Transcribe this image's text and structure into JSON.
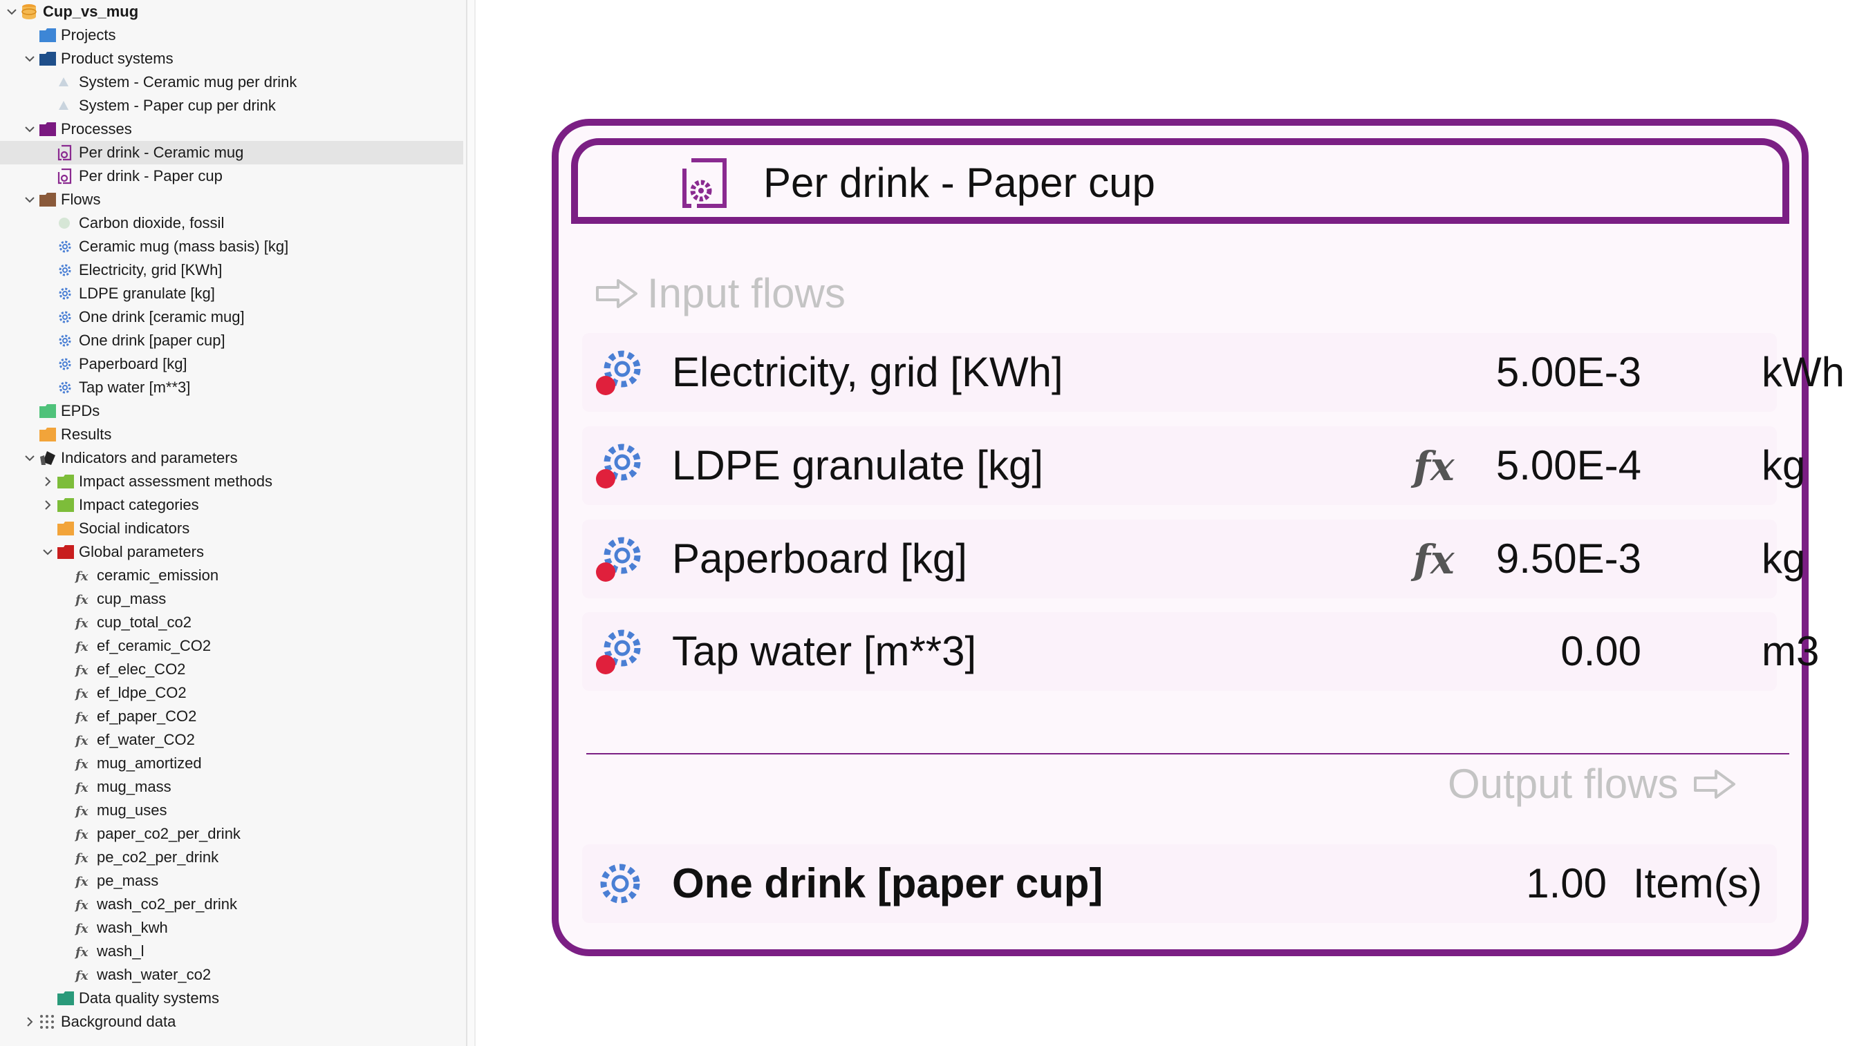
{
  "tree": {
    "root": "Cup_vs_mug",
    "items": [
      {
        "label": "Projects",
        "icon": "folder-blue-icon"
      },
      {
        "label": "Product systems",
        "icon": "folder-navy-icon"
      },
      {
        "label": "System - Ceramic mug per drink",
        "icon": "product-system-icon"
      },
      {
        "label": "System - Paper cup per drink",
        "icon": "product-system-icon"
      },
      {
        "label": "Processes",
        "icon": "folder-purple-icon"
      },
      {
        "label": "Per drink - Ceramic mug",
        "icon": "process-icon"
      },
      {
        "label": "Per drink - Paper cup",
        "icon": "process-icon"
      },
      {
        "label": "Flows",
        "icon": "folder-brown-icon"
      },
      {
        "label": "Carbon dioxide, fossil",
        "icon": "elementary-flow-icon"
      },
      {
        "label": "Ceramic mug (mass basis) [kg]",
        "icon": "product-flow-icon"
      },
      {
        "label": "Electricity, grid [KWh]",
        "icon": "product-flow-icon"
      },
      {
        "label": "LDPE granulate [kg]",
        "icon": "product-flow-icon"
      },
      {
        "label": "One drink [ceramic mug]",
        "icon": "product-flow-icon"
      },
      {
        "label": "One drink [paper cup]",
        "icon": "product-flow-icon"
      },
      {
        "label": "Paperboard [kg]",
        "icon": "product-flow-icon"
      },
      {
        "label": "Tap water [m**3]",
        "icon": "product-flow-icon"
      },
      {
        "label": "EPDs",
        "icon": "folder-green-icon"
      },
      {
        "label": "Results",
        "icon": "folder-orange-icon"
      },
      {
        "label": "Indicators and parameters",
        "icon": "indicators-icon"
      },
      {
        "label": "Impact assessment methods",
        "icon": "folder-lime-icon"
      },
      {
        "label": "Impact categories",
        "icon": "folder-lime-icon"
      },
      {
        "label": "Social indicators",
        "icon": "folder-orange-icon"
      },
      {
        "label": "Global parameters",
        "icon": "folder-red-icon"
      },
      {
        "label": "ceramic_emission",
        "icon": "fx-parameter-icon"
      },
      {
        "label": "cup_mass",
        "icon": "fx-parameter-icon"
      },
      {
        "label": "cup_total_co2",
        "icon": "fx-parameter-icon"
      },
      {
        "label": "ef_ceramic_CO2",
        "icon": "fx-parameter-icon"
      },
      {
        "label": "ef_elec_CO2",
        "icon": "fx-parameter-icon"
      },
      {
        "label": "ef_ldpe_CO2",
        "icon": "fx-parameter-icon"
      },
      {
        "label": "ef_paper_CO2",
        "icon": "fx-parameter-icon"
      },
      {
        "label": "ef_water_CO2",
        "icon": "fx-parameter-icon"
      },
      {
        "label": "mug_amortized",
        "icon": "fx-parameter-icon"
      },
      {
        "label": "mug_mass",
        "icon": "fx-parameter-icon"
      },
      {
        "label": "mug_uses",
        "icon": "fx-parameter-icon"
      },
      {
        "label": "paper_co2_per_drink",
        "icon": "fx-parameter-icon"
      },
      {
        "label": "pe_co2_per_drink",
        "icon": "fx-parameter-icon"
      },
      {
        "label": "pe_mass",
        "icon": "fx-parameter-icon"
      },
      {
        "label": "wash_co2_per_drink",
        "icon": "fx-parameter-icon"
      },
      {
        "label": "wash_kwh",
        "icon": "fx-parameter-icon"
      },
      {
        "label": "wash_l",
        "icon": "fx-parameter-icon"
      },
      {
        "label": "wash_water_co2",
        "icon": "fx-parameter-icon"
      },
      {
        "label": "Data quality systems",
        "icon": "folder-teal-icon"
      },
      {
        "label": "Background data",
        "icon": "grid-dots-icon"
      }
    ]
  },
  "card": {
    "title": "Per drink - Paper cup",
    "input_title": "Input flows",
    "output_title": "Output flows",
    "inputs": [
      {
        "name": "Electricity, grid [KWh]",
        "amount": "5.00E-3",
        "unit": "kWh",
        "formula": false
      },
      {
        "name": "LDPE granulate [kg]",
        "amount": "5.00E-4",
        "unit": "kg",
        "formula": true
      },
      {
        "name": "Paperboard [kg]",
        "amount": "9.50E-3",
        "unit": "kg",
        "formula": true
      },
      {
        "name": "Tap water [m**3]",
        "amount": "0.00",
        "unit": "m3",
        "formula": false
      }
    ],
    "outputs": [
      {
        "name": "One drink [paper cup]",
        "amount": "1.00",
        "unit": "Item(s)",
        "formula": false
      }
    ]
  },
  "colors": {
    "accent": "#7b1f84",
    "card_bg": "#fdf7fc",
    "section_title": "#c4c4c4",
    "gear_blue": "#4a7fd4",
    "input_dot": "#e0203c"
  }
}
